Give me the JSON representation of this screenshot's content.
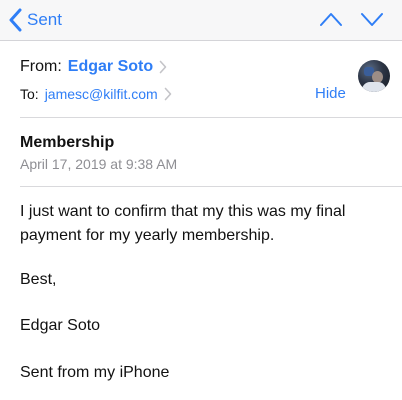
{
  "navbar": {
    "back_label": "Sent",
    "accent_color": "#2f7ef6"
  },
  "header": {
    "from_label": "From:",
    "from_name": "Edgar Soto",
    "to_label": "To:",
    "to_address": "jamesc@kilfit.com",
    "hide_label": "Hide",
    "subject": "Membership",
    "date": "April 17, 2019 at 9:38 AM"
  },
  "body": {
    "paragraph_1": "I just want to confirm that my this was my final payment for my yearly membership.",
    "paragraph_2": "Best,",
    "paragraph_3": "Edgar Soto",
    "paragraph_4": "Sent from my iPhone"
  },
  "icons": {
    "back": "chevron-left-icon",
    "prev": "chevron-up-icon",
    "next": "chevron-down-icon",
    "disclosure": "chevron-right-icon"
  }
}
